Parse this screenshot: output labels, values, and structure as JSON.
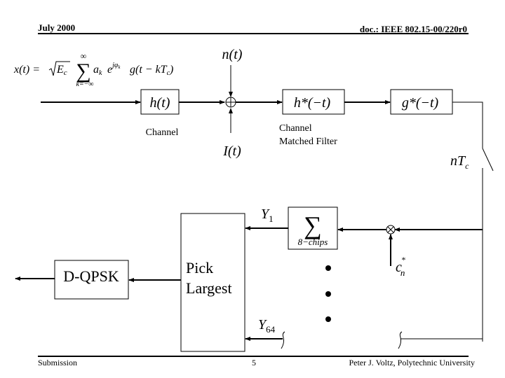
{
  "header": {
    "date": "July 2000",
    "doc_id": "doc.: IEEE 802.15-00/220r0"
  },
  "footer": {
    "left": "Submission",
    "page_number": "5",
    "author": "Peter J. Voltz, Polytechnic University"
  },
  "equation": {
    "lhs": "x(t) = ",
    "sqrt_arg": "E",
    "sqrt_sub": "c",
    "sum_upper": "∞",
    "sum_lower": "k=−∞",
    "sum_symbol": "∑",
    "term_a": "a",
    "term_a_sub": "k",
    "term_e": "e",
    "term_e_sup": "jφ",
    "term_e_sup_sub": "k",
    "term_g": "g(t − kT",
    "term_g_sub": "c",
    "term_g_close": ")"
  },
  "blocks": {
    "channel": {
      "expr": "h(t)",
      "caption": "Channel"
    },
    "matched_filter": {
      "expr": "h*(−t)",
      "caption_line1": "Channel",
      "caption_line2": "Matched Filter"
    },
    "pulse_filter": {
      "expr": "g*(−t)"
    },
    "summer": {
      "symbol": "∑",
      "caption": "8−chips"
    },
    "pick_largest": {
      "line1": "Pick",
      "line2": "Largest"
    },
    "dqpsk": {
      "label": "D-QPSK"
    }
  },
  "signals": {
    "noise": "n(t)",
    "interference": "I(t)",
    "sampler": "nT",
    "sampler_sub": "c",
    "code_chip": "c",
    "code_chip_sup": "*",
    "code_chip_sub": "n",
    "y1": "Y",
    "y1_sub": "1",
    "y64": "Y",
    "y64_sub": "64"
  }
}
